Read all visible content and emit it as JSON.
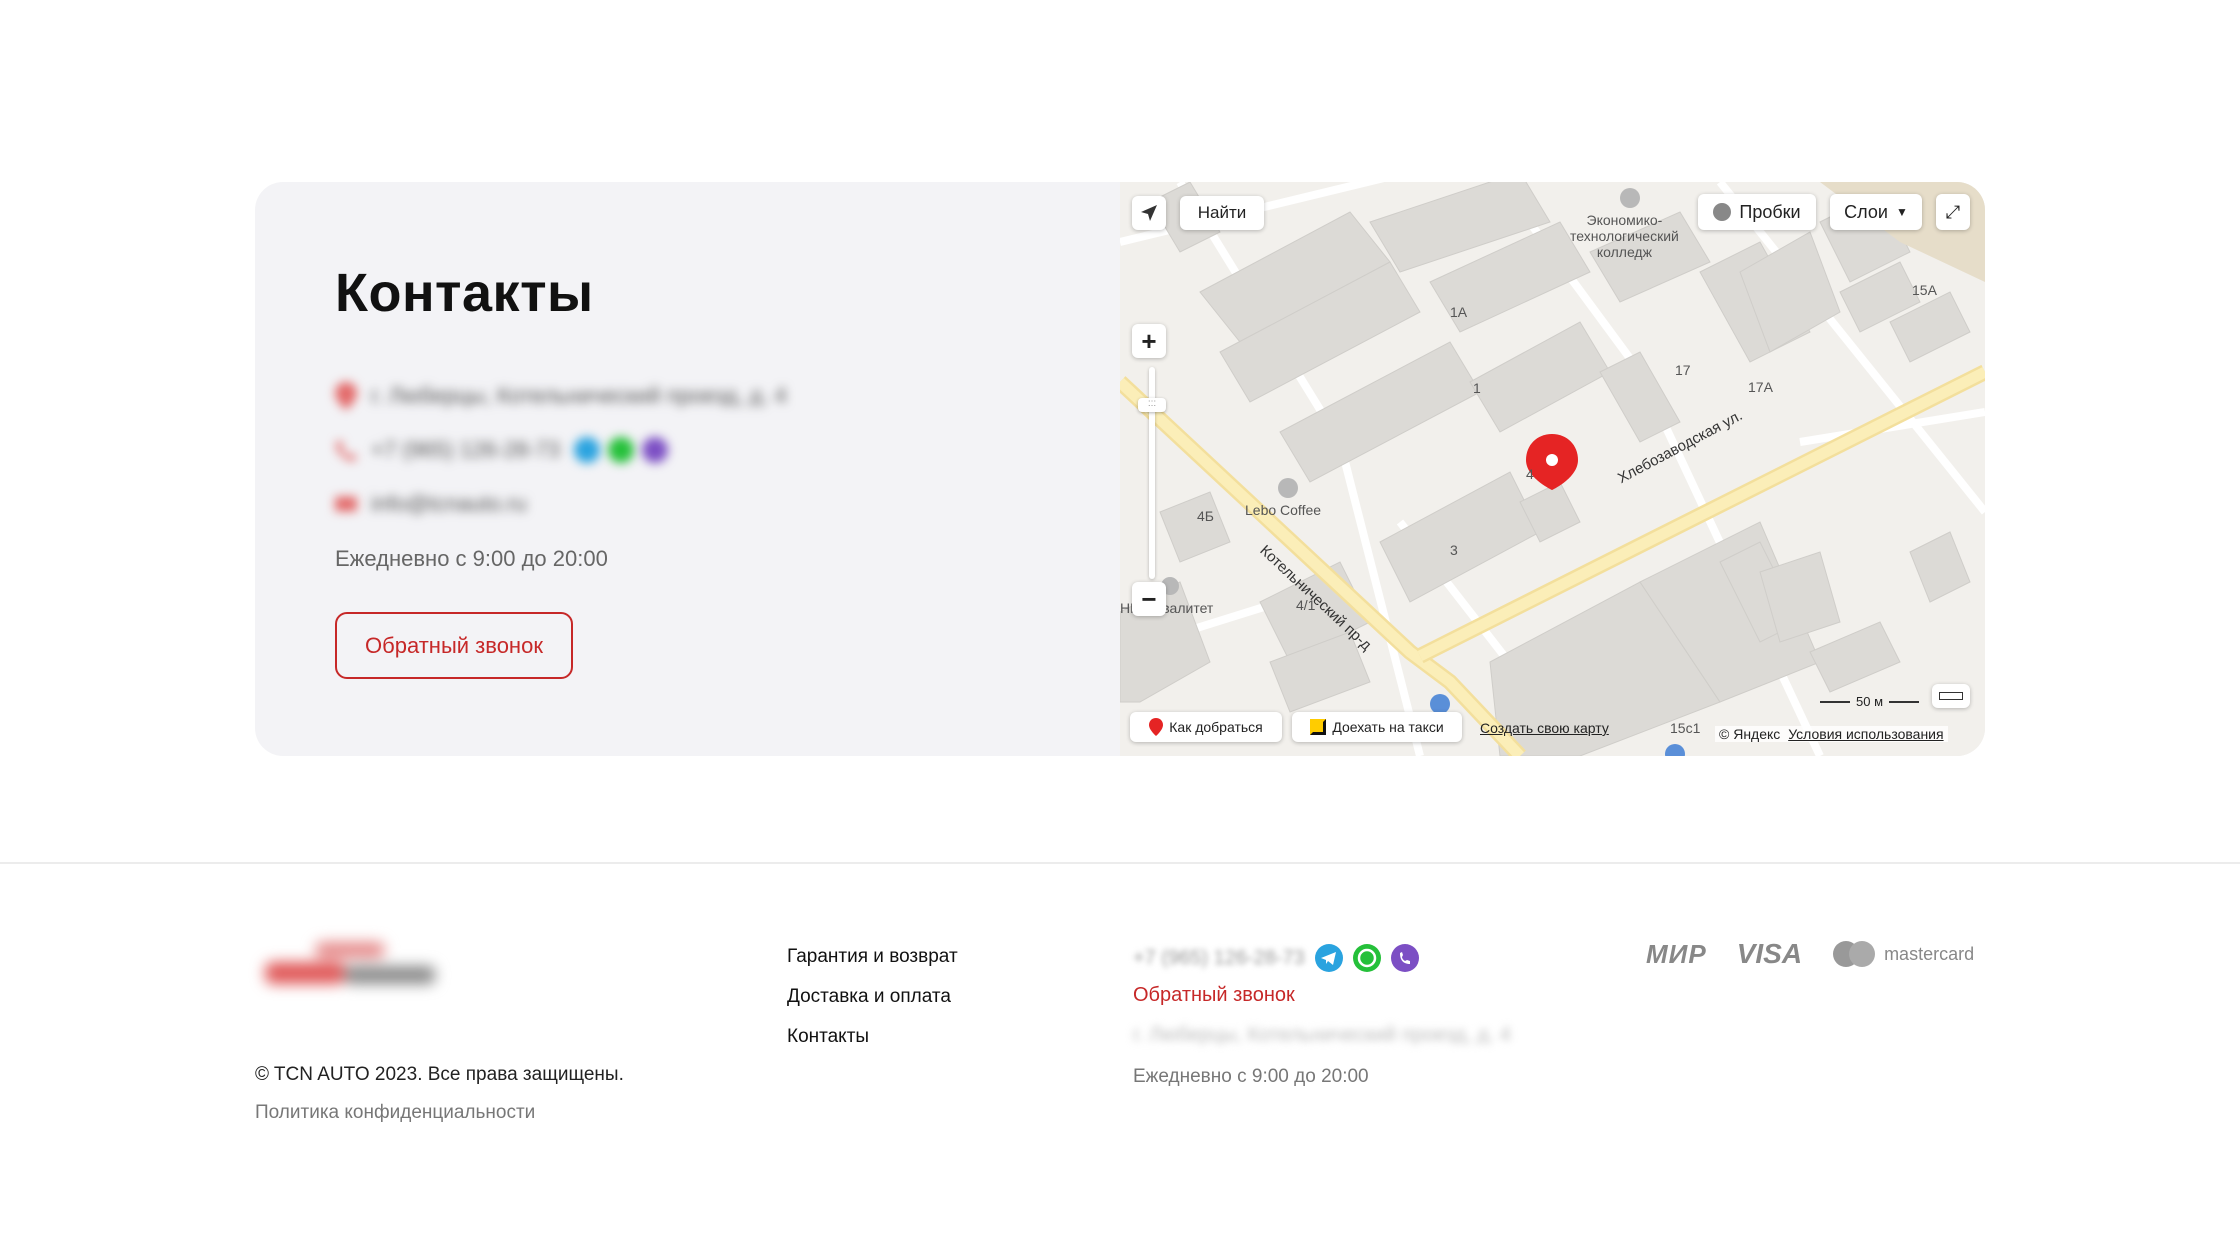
{
  "contacts": {
    "title": "Контакты",
    "address": "г. Люберцы, Котельнический проезд, д. 4",
    "phone": "+7 (965) 126-28-73",
    "email": "info@tcnauto.ru",
    "hours": "Ежедневно с 9:00 до 20:00",
    "callback_label": "Обратный звонок"
  },
  "map": {
    "find_label": "Найти",
    "traffic_label": "Пробки",
    "layers_label": "Слои",
    "poi_college": [
      "Экономико-",
      "технологический",
      "колледж"
    ],
    "poi_cafe": "Lebo Coffee",
    "poi_npp": "НПП Квалитет",
    "street_1": "Хлебозаводская ул.",
    "street_2": "Котельнический пр-д",
    "house_numbers": [
      "1А",
      "1",
      "17",
      "17А",
      "15А",
      "4Б",
      "4/1",
      "3",
      "4",
      "15с1"
    ],
    "route_label": "Как добраться",
    "taxi_label": "Доехать на такси",
    "create_map_label": "Создать свою карту",
    "scale_label": "50 м",
    "copyright": "© Яндекс",
    "terms_label": "Условия использования"
  },
  "footer": {
    "logo_text": "TCN AUTO",
    "copyright": "© TCN AUTO 2023. Все права защищены.",
    "privacy": "Политика конфиденциальности",
    "nav": [
      "Гарантия и возврат",
      "Доставка и оплата",
      "Контакты"
    ],
    "phone": "+7 (965) 126-28-73",
    "callback": "Обратный звонок",
    "address": "г. Люберцы, Котельнический проезд, д. 4",
    "hours": "Ежедневно с 9:00 до 20:00",
    "payments": {
      "mir": "МИР",
      "visa": "VISA",
      "mastercard": "mastercard"
    }
  },
  "colors": {
    "accent": "#c62828",
    "telegram": "#2aa3df",
    "whatsapp": "#25c03a",
    "viber": "#7c4fc4",
    "card_bg": "#f3f3f6"
  }
}
